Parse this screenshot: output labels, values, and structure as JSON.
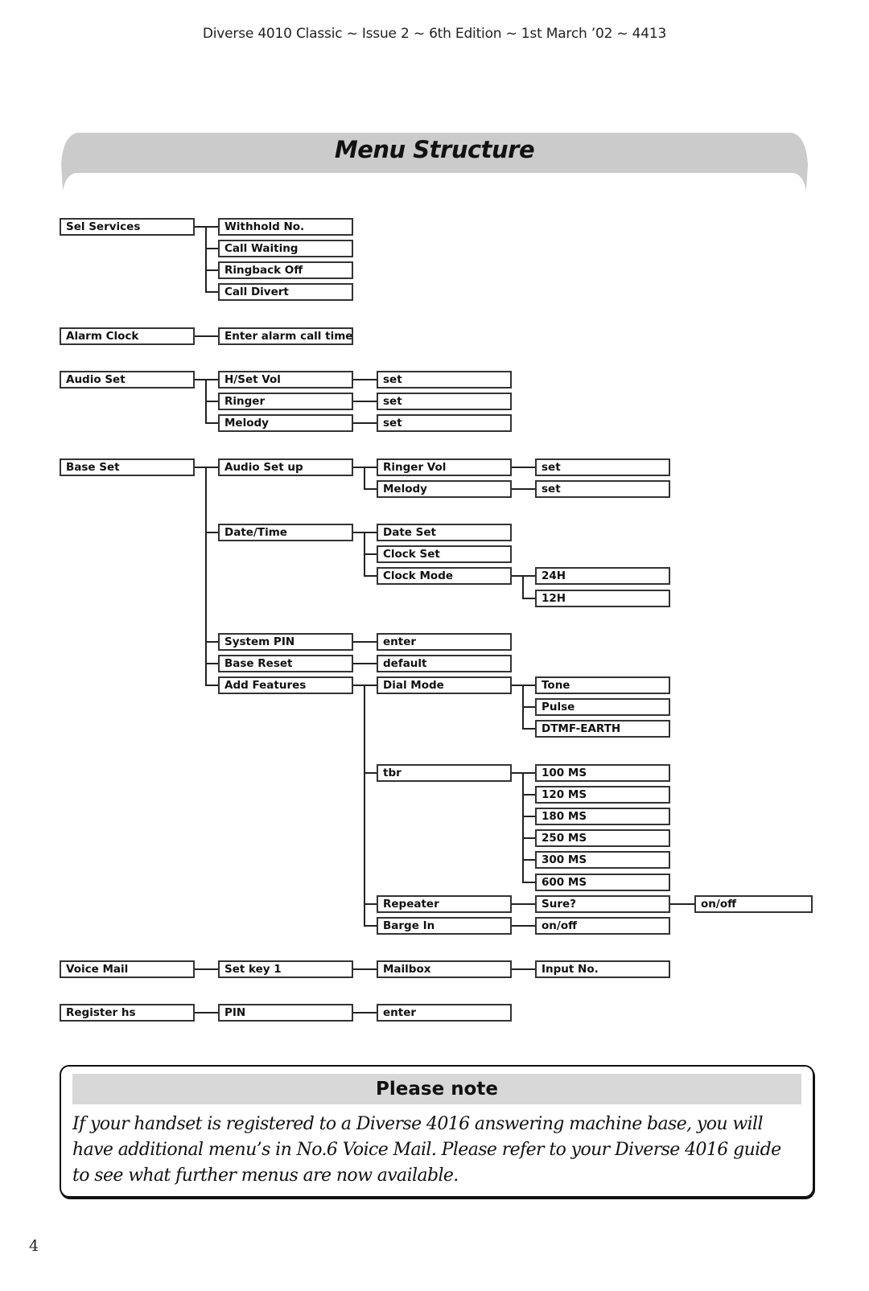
{
  "header": {
    "running_head": "Diverse 4010 Classic ~ Issue 2 ~ 6th Edition ~ 1st March ’02 ~ 4413",
    "title": "Menu Structure"
  },
  "menu": [
    {
      "label": "Sel Services",
      "row": 0,
      "children": [
        {
          "label": "Withhold No.",
          "row": 0
        },
        {
          "label": "Call Waiting",
          "row": 1
        },
        {
          "label": "Ringback Off",
          "row": 2
        },
        {
          "label": "Call Divert",
          "row": 3
        }
      ]
    },
    {
      "label": "Alarm Clock",
      "row": 5,
      "children": [
        {
          "label": "Enter alarm call time",
          "row": 5
        }
      ]
    },
    {
      "label": "Audio Set",
      "row": 7,
      "children": [
        {
          "label": "H/Set Vol",
          "row": 7,
          "children": [
            {
              "label": "set",
              "row": 7
            }
          ]
        },
        {
          "label": "Ringer",
          "row": 8,
          "children": [
            {
              "label": "set",
              "row": 8
            }
          ]
        },
        {
          "label": "Melody",
          "row": 9,
          "children": [
            {
              "label": "set",
              "row": 9
            }
          ]
        }
      ]
    },
    {
      "label": "Base Set",
      "row": 11,
      "children": [
        {
          "label": "Audio Set up",
          "row": 11,
          "children": [
            {
              "label": "Ringer Vol",
              "row": 11,
              "children": [
                {
                  "label": "set",
                  "row": 11
                }
              ]
            },
            {
              "label": "Melody",
              "row": 12,
              "children": [
                {
                  "label": "set",
                  "row": 12
                }
              ]
            }
          ]
        },
        {
          "label": "Date/Time",
          "row": 14,
          "children": [
            {
              "label": "Date Set",
              "row": 14
            },
            {
              "label": "Clock Set",
              "row": 15
            },
            {
              "label": "Clock Mode",
              "row": 16,
              "children": [
                {
                  "label": "24H",
                  "row": 16
                },
                {
                  "label": "12H",
                  "row": 17
                }
              ]
            }
          ]
        },
        {
          "label": "System PIN",
          "row": 19,
          "children": [
            {
              "label": "enter",
              "row": 19
            }
          ]
        },
        {
          "label": "Base Reset",
          "row": 20,
          "children": [
            {
              "label": "default",
              "row": 20
            }
          ]
        },
        {
          "label": "Add Features",
          "row": 21,
          "children": [
            {
              "label": "Dial Mode",
              "row": 21,
              "children": [
                {
                  "label": "Tone",
                  "row": 21
                },
                {
                  "label": "Pulse",
                  "row": 22
                },
                {
                  "label": "DTMF-EARTH",
                  "row": 23
                }
              ]
            },
            {
              "label": "tbr",
              "row": 25,
              "children": [
                {
                  "label": "100 MS",
                  "row": 25
                },
                {
                  "label": "120 MS",
                  "row": 26
                },
                {
                  "label": "180 MS",
                  "row": 27
                },
                {
                  "label": "250 MS",
                  "row": 28
                },
                {
                  "label": "300 MS",
                  "row": 29
                },
                {
                  "label": "600 MS",
                  "row": 30
                }
              ]
            },
            {
              "label": "Repeater",
              "row": 31,
              "children": [
                {
                  "label": "Sure?",
                  "row": 31,
                  "children": [
                    {
                      "label": "on/off",
                      "row": 31
                    }
                  ]
                }
              ]
            },
            {
              "label": "Barge In",
              "row": 32,
              "children": [
                {
                  "label": "on/off",
                  "row": 32
                }
              ]
            }
          ]
        }
      ]
    },
    {
      "label": "Voice Mail",
      "row": 34,
      "children": [
        {
          "label": "Set key 1",
          "row": 34,
          "children": [
            {
              "label": "Mailbox",
              "row": 34,
              "children": [
                {
                  "label": "Input No.",
                  "row": 34
                }
              ]
            }
          ]
        }
      ]
    },
    {
      "label": "Register hs",
      "row": 36,
      "children": [
        {
          "label": "PIN",
          "row": 36,
          "children": [
            {
              "label": "enter",
              "row": 36
            }
          ]
        }
      ]
    }
  ],
  "note": {
    "heading": "Please note",
    "text": "If your handset is registered to a Diverse 4016 answering machine base, you will have additional menu’s in No.6 Voice Mail. Please refer to your Diverse 4016 guide to see what further menus are now available."
  },
  "footer": {
    "page_number": "4"
  }
}
